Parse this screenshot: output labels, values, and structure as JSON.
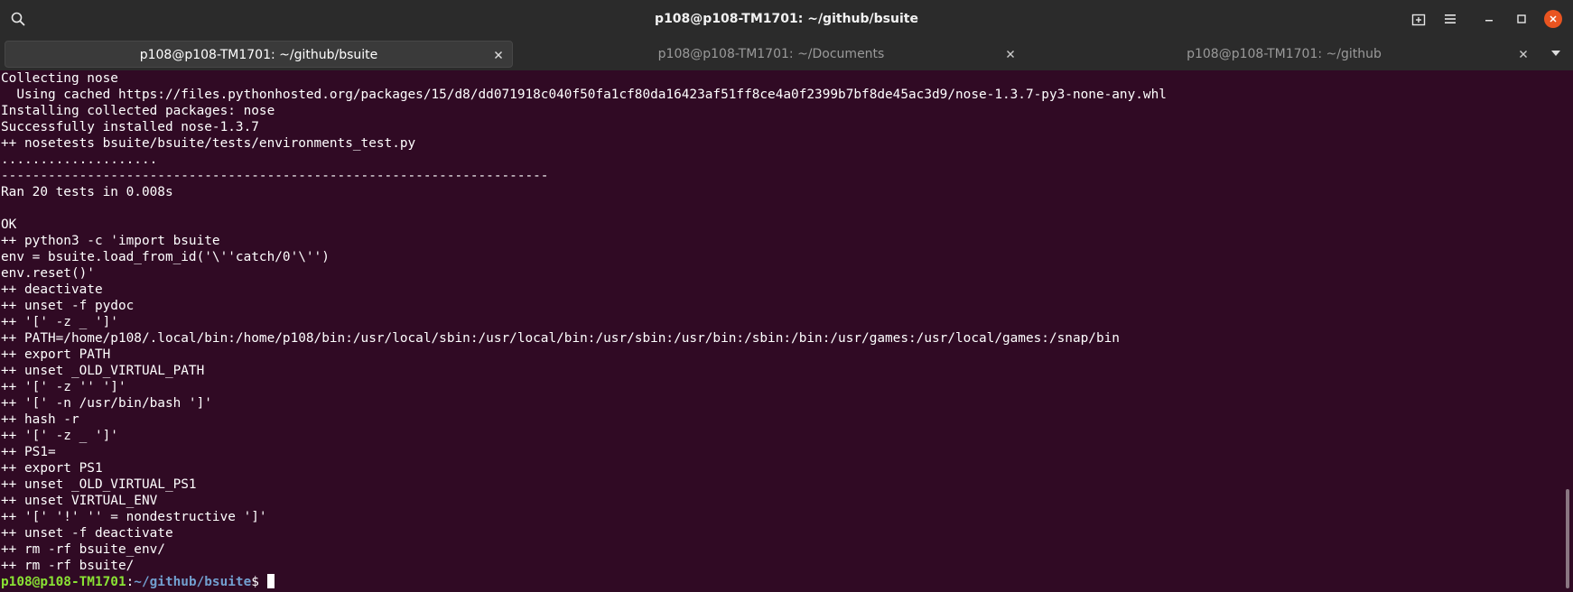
{
  "window": {
    "title": "p108@p108-TM1701: ~/github/bsuite"
  },
  "header": {
    "search_icon": "search-icon",
    "new_tab_icon": "new-tab-icon",
    "menu_icon": "hamburger-menu-icon",
    "minimize_icon": "minimize-icon",
    "maximize_icon": "maximize-icon",
    "close_icon": "close-icon",
    "close_color": "#e95420"
  },
  "tabs": [
    {
      "label": "p108@p108-TM1701: ~/github/bsuite",
      "active": true
    },
    {
      "label": "p108@p108-TM1701: ~/Documents",
      "active": false
    },
    {
      "label": "p108@p108-TM1701: ~/github",
      "active": false
    }
  ],
  "terminal": {
    "background": "#300a24",
    "lines": [
      "Collecting nose",
      "  Using cached https://files.pythonhosted.org/packages/15/d8/dd071918c040f50fa1cf80da16423af51ff8ce4a0f2399b7bf8de45ac3d9/nose-1.3.7-py3-none-any.whl",
      "Installing collected packages: nose",
      "Successfully installed nose-1.3.7",
      "++ nosetests bsuite/bsuite/tests/environments_test.py",
      "....................",
      "----------------------------------------------------------------------",
      "Ran 20 tests in 0.008s",
      "",
      "OK",
      "++ python3 -c 'import bsuite",
      "env = bsuite.load_from_id('\\''catch/0'\\'')",
      "env.reset()'",
      "++ deactivate",
      "++ unset -f pydoc",
      "++ '[' -z _ ']'",
      "++ PATH=/home/p108/.local/bin:/home/p108/bin:/usr/local/sbin:/usr/local/bin:/usr/sbin:/usr/bin:/sbin:/bin:/usr/games:/usr/local/games:/snap/bin",
      "++ export PATH",
      "++ unset _OLD_VIRTUAL_PATH",
      "++ '[' -z '' ']'",
      "++ '[' -n /usr/bin/bash ']'",
      "++ hash -r",
      "++ '[' -z _ ']'",
      "++ PS1=",
      "++ export PS1",
      "++ unset _OLD_VIRTUAL_PS1",
      "++ unset VIRTUAL_ENV",
      "++ '[' '!' '' = nondestructive ']'",
      "++ unset -f deactivate",
      "++ rm -rf bsuite_env/",
      "++ rm -rf bsuite/"
    ],
    "prompt": {
      "user_host": "p108@p108-TM1701",
      "separator": ":",
      "path": "~/github/bsuite",
      "symbol": "$ ",
      "user_color": "#8ae234",
      "path_color": "#729fcf"
    }
  }
}
